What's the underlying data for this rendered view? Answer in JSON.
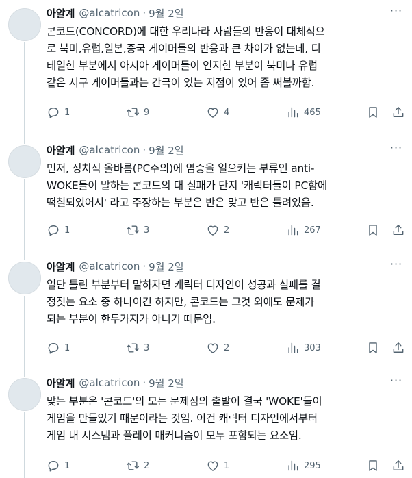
{
  "tweets": [
    {
      "name": "아알계",
      "handle": "@alcatricon",
      "dot": "·",
      "date": "9월 2일",
      "more": "···",
      "text": "콘코드(CONCORD)에 대한 우리나라 사람들의 반응이 대체적으\n로 북미,유럽,일본,중국 게이머들의 반응과 큰 차이가 없는데, 디\n테일한 부분에서 아시아 게이머들이 인지한 부분이 북미나 유럽\n같은 서구 게이머들과는 간극이 있는 지점이 있어 좀 써볼까함.",
      "replies": "1",
      "retweets": "9",
      "likes": "4",
      "views": "465"
    },
    {
      "name": "아알계",
      "handle": "@alcatricon",
      "dot": "·",
      "date": "9월 2일",
      "more": "···",
      "text": "먼저, 정치적 올바름(PC주의)에 염증을 일으키는 부류인 anti-\nWOKE들이 말하는 콘코드의 대 실패가 단지 '캐릭터들이 PC함에\n떡칠되있어서' 라고 주장하는 부분은 반은 맞고 반은 틀려있음.",
      "replies": "1",
      "retweets": "3",
      "likes": "2",
      "views": "267"
    },
    {
      "name": "아알계",
      "handle": "@alcatricon",
      "dot": "·",
      "date": "9월 2일",
      "more": "···",
      "text": "일단 틀린 부분부터 말하자면 캐릭터 디자인이 성공과 실패를 결\n정짓는 요소 중 하나이긴 하지만, 콘코드는 그것 외에도 문제가\n되는 부분이 한두가지가 아니기 때문임.",
      "replies": "1",
      "retweets": "3",
      "likes": "2",
      "views": "303"
    },
    {
      "name": "아알계",
      "handle": "@alcatricon",
      "dot": "·",
      "date": "9월 2일",
      "more": "···",
      "text": "맞는 부분은 '콘코드'의 모든 문제점의 출발이 결국 'WOKE'들이\n게임을 만들었기 때문이라는 것임. 이건 캐릭터 디자인에서부터\n게임 내 시스템과 플레이 매커니즘이 모두 포함되는 요소임.",
      "replies": "1",
      "retweets": "2",
      "likes": "1",
      "views": "295"
    }
  ],
  "icons": {
    "reply": "reply-icon",
    "retweet": "retweet-icon",
    "like": "heart-icon",
    "views": "views-icon",
    "bookmark": "bookmark-icon",
    "share": "share-icon"
  },
  "colors": {
    "text": "#0f1419",
    "secondary": "#536471",
    "thread_line": "#cfd9de"
  }
}
